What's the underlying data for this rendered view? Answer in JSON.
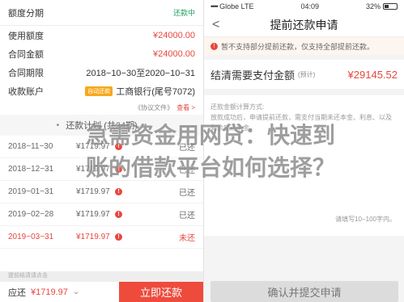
{
  "left": {
    "header": {
      "title": "额度分期",
      "status": "还款中"
    },
    "details": [
      {
        "label": "使用额度",
        "value": "¥24000.00"
      },
      {
        "label": "合同金额",
        "value": "¥24000.00"
      },
      {
        "label": "合同期限",
        "value": "2018−10−30至2020−10−31"
      }
    ],
    "account": {
      "label": "收款账户",
      "badge": "自动还款",
      "value": "工商银行(尾号7072)"
    },
    "protocol": {
      "text": "《协议文件》",
      "link": "查看 >"
    },
    "plan": {
      "title": "还款计划 (共24期)"
    },
    "rows": [
      {
        "date": "2018−11−30",
        "amount": "¥1719.97",
        "status": "已还"
      },
      {
        "date": "2018−12−31",
        "amount": "¥1719.97",
        "status": "已还"
      },
      {
        "date": "2019−01−31",
        "amount": "¥1719.97",
        "status": "已还"
      },
      {
        "date": "2019−02−28",
        "amount": "¥1719.97",
        "status": "已还"
      },
      {
        "date": "2019−03−31",
        "amount": "¥1719.97",
        "status": "未还",
        "overdue": true
      }
    ],
    "strip": "提前结清请点击",
    "bottom": {
      "due_label": "应还",
      "due_value": "¥1719.97",
      "repay_button": "立即还款"
    }
  },
  "right": {
    "status_bar": {
      "carrier": "Globe",
      "network": "LTE",
      "time": "04:09",
      "battery": "32%"
    },
    "nav": {
      "title": "提前还款申请",
      "back": "<"
    },
    "notice": "暂不支持部分提前还款，仅支持全部提前还款。",
    "need": {
      "label": "结清需要支付金额",
      "hint": "(预计)",
      "amount": "¥29145.52"
    },
    "method": {
      "title": "还款金额计算方式:",
      "body": "放款成功后，申请提前还款，需支付当期未还本金、利息、以及剩余应还本金。",
      "limit": "请填写10−100字内。"
    },
    "submit": "确认并提交申请"
  },
  "overlay": {
    "line1": "急需资金用网贷：快速到",
    "line2": "账的借款平台如何选择？"
  }
}
